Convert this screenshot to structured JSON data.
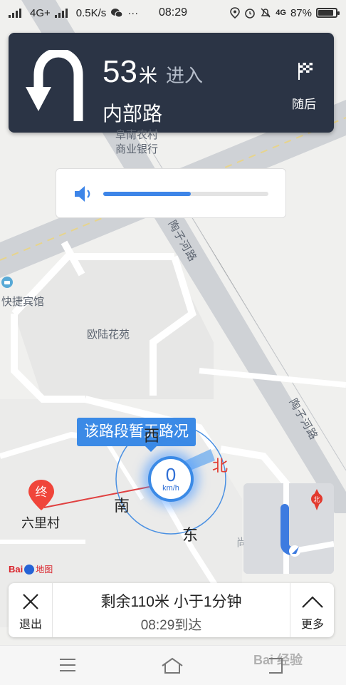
{
  "status_bar": {
    "network": "4G+",
    "speed": "0.5K/s",
    "more": "···",
    "time": "08:29",
    "network2": "4G",
    "battery": "87%",
    "battery_level": 0.87
  },
  "nav_card": {
    "distance_value": "53",
    "distance_unit": "米",
    "action": "进入",
    "road_name": "内部路",
    "later_label": "随后",
    "turn_icon": "u-turn-left-icon",
    "flag_icon": "checkered-flag-icon"
  },
  "volume": {
    "icon": "speaker-icon",
    "level": 0.53
  },
  "map": {
    "labels": {
      "bank": "阜南农村\n商业银行",
      "bank_line1": "阜南农村",
      "bank_line2": "商业银行",
      "road_tao": "陶子河路",
      "road_tao2": "陶子河路",
      "hotel": "快捷宾馆",
      "garden": "欧陆花苑",
      "village": "六里村",
      "shangding": "尚鼎国际"
    },
    "compass": {
      "north": "北",
      "south": "南",
      "east": "东",
      "west": "西"
    },
    "tooltip": "该路段暂无路况",
    "speed_value": "0",
    "speed_unit": "km/h",
    "end_marker": "终",
    "logo_text": "Bai",
    "logo_text2": "地图"
  },
  "bottom_bar": {
    "exit_label": "退出",
    "remaining": "剩余110米 小于1分钟",
    "arrival": "08:29到达",
    "more_label": "更多"
  },
  "watermark": "Bai 经验"
}
